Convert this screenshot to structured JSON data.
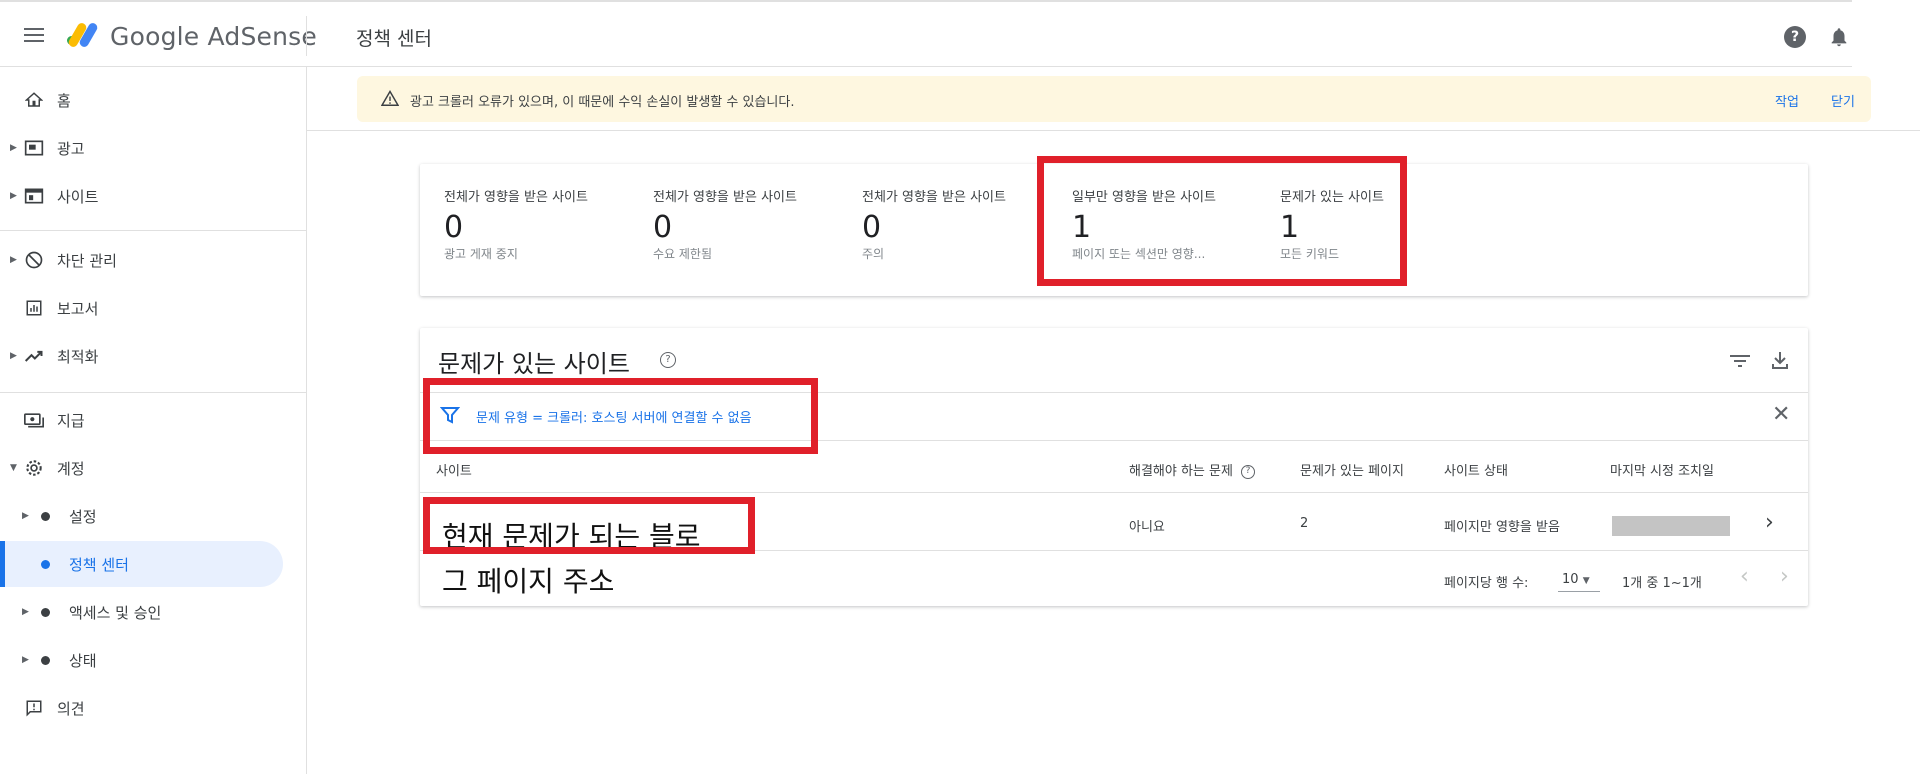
{
  "header": {
    "app_name": "Google AdSense",
    "page_title": "정책 센터"
  },
  "sidebar": {
    "items": [
      {
        "label": "홈"
      },
      {
        "label": "광고"
      },
      {
        "label": "사이트"
      },
      {
        "label": "차단 관리"
      },
      {
        "label": "보고서"
      },
      {
        "label": "최적화"
      },
      {
        "label": "지급"
      },
      {
        "label": "계정"
      },
      {
        "label": "설정"
      },
      {
        "label": "정책 센터"
      },
      {
        "label": "액세스 및 승인"
      },
      {
        "label": "상태"
      },
      {
        "label": "의견"
      }
    ]
  },
  "alert": {
    "message": "광고 크롤러 오류가 있으며, 이 때문에 수익 손실이 발생할 수 있습니다.",
    "action_label": "작업",
    "dismiss_label": "닫기"
  },
  "summary": {
    "stats": [
      {
        "title": "전체가 영향을 받은 사이트",
        "value": "0",
        "sub": "광고 게재 중지"
      },
      {
        "title": "전체가 영향을 받은 사이트",
        "value": "0",
        "sub": "수요 제한됨"
      },
      {
        "title": "전체가 영향을 받은 사이트",
        "value": "0",
        "sub": "주의"
      },
      {
        "title": "일부만 영향을 받은 사이트",
        "value": "1",
        "sub": "페이지 또는 섹션만 영향..."
      },
      {
        "title": "문제가 있는 사이트",
        "value": "1",
        "sub": "모든 키워드"
      }
    ]
  },
  "table": {
    "title": "문제가 있는 사이트",
    "filter_chip": "문제 유형 = 크롤러: 호스팅 서버에 연결할 수 없음",
    "columns": [
      "사이트",
      "해결해야 하는 문제",
      "문제가 있는 페이지",
      "사이트 상태",
      "마지막 시정 조치일"
    ],
    "rows": [
      {
        "site": "현재 문제가 되는 블로",
        "must_fix": "아니요",
        "pages": "2",
        "status": "페이지만 영향을 받음"
      }
    ],
    "overlay_line2": "그 페이지 주소",
    "pagination": {
      "rows_per_page_label": "페이지당 행 수:",
      "rows_per_page": "10",
      "range": "1개 중 1~1개"
    }
  },
  "colors": {
    "accent": "#1a73e8",
    "annotation_red": "#e0202a",
    "alert_bg": "#fef7e0"
  },
  "icons": {
    "logo": "adsense-logo-icon",
    "help": "help-icon",
    "notifications": "bell-icon"
  }
}
